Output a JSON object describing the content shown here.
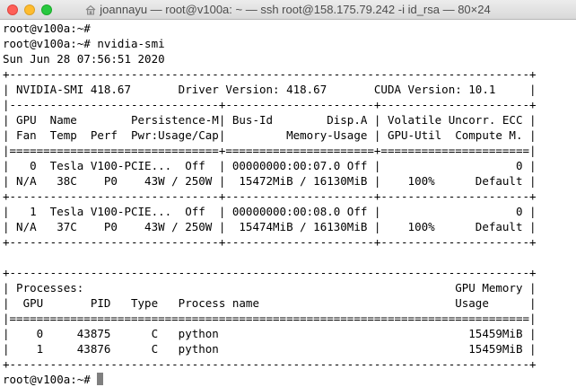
{
  "window": {
    "title": "joannayu — root@v100a: ~ — ssh root@158.175.79.242 -i id_rsa — 80×24",
    "colors": {
      "background": "#ffffff",
      "text": "#000000",
      "cursor": "#7f7f7f"
    }
  },
  "terminal": {
    "lines": [
      "root@v100a:~#",
      "root@v100a:~# nvidia-smi",
      "Sun Jun 28 07:56:51 2020",
      "+-----------------------------------------------------------------------------+",
      "| NVIDIA-SMI 418.67       Driver Version: 418.67       CUDA Version: 10.1     |",
      "|-------------------------------+----------------------+----------------------+",
      "| GPU  Name        Persistence-M| Bus-Id        Disp.A | Volatile Uncorr. ECC |",
      "| Fan  Temp  Perf  Pwr:Usage/Cap|         Memory-Usage | GPU-Util  Compute M. |",
      "|===============================+======================+======================|",
      "|   0  Tesla V100-PCIE...  Off  | 00000000:00:07.0 Off |                    0 |",
      "| N/A   38C    P0    43W / 250W |  15472MiB / 16130MiB |    100%      Default |",
      "+-------------------------------+----------------------+----------------------+",
      "|   1  Tesla V100-PCIE...  Off  | 00000000:00:08.0 Off |                    0 |",
      "| N/A   37C    P0    43W / 250W |  15474MiB / 16130MiB |    100%      Default |",
      "+-------------------------------+----------------------+----------------------+",
      "",
      "+-----------------------------------------------------------------------------+",
      "| Processes:                                                       GPU Memory |",
      "|  GPU       PID   Type   Process name                             Usage      |",
      "|=============================================================================|",
      "|    0     43875      C   python                                     15459MiB |",
      "|    1     43876      C   python                                     15459MiB |",
      "+-----------------------------------------------------------------------------+",
      "root@v100a:~# "
    ]
  }
}
